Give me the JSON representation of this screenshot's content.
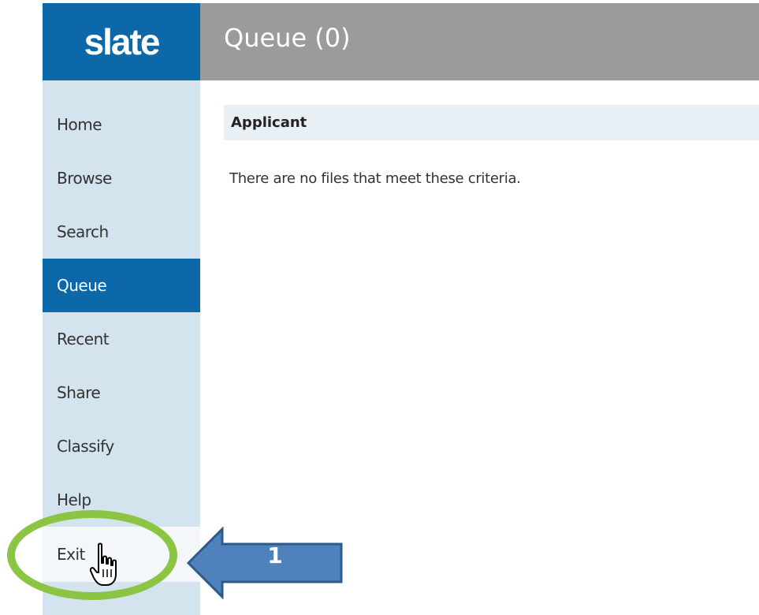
{
  "brand": {
    "logo_text": "slate"
  },
  "header": {
    "title": "Queue (0)"
  },
  "sidebar": {
    "items": [
      {
        "label": "Home"
      },
      {
        "label": "Browse"
      },
      {
        "label": "Search"
      },
      {
        "label": "Queue",
        "active": true
      },
      {
        "label": "Recent"
      },
      {
        "label": "Share"
      },
      {
        "label": "Classify"
      },
      {
        "label": "Help"
      },
      {
        "label": "Exit"
      }
    ]
  },
  "main": {
    "section_header": "Applicant",
    "empty_message": "There are no files that meet these criteria."
  },
  "annotation": {
    "step_number": "1",
    "highlight_color": "#8cc444",
    "arrow_color": "#4f81bd"
  },
  "colors": {
    "brand_blue": "#0c68a8",
    "header_gray": "#9b9b9b",
    "sidebar_bg": "#d4e4ef",
    "section_bg": "#e8eff5"
  },
  "icons": {
    "cursor": "hand-pointer-icon"
  }
}
